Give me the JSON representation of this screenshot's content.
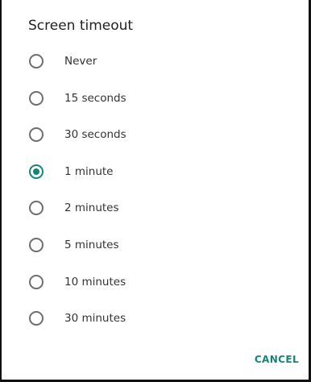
{
  "dialog": {
    "title": "Screen timeout",
    "accent_color": "#15857a",
    "options": [
      {
        "label": "Never",
        "selected": false
      },
      {
        "label": "15 seconds",
        "selected": false
      },
      {
        "label": "30 seconds",
        "selected": false
      },
      {
        "label": "1 minute",
        "selected": true
      },
      {
        "label": "2 minutes",
        "selected": false
      },
      {
        "label": "5 minutes",
        "selected": false
      },
      {
        "label": "10 minutes",
        "selected": false
      },
      {
        "label": "30 minutes",
        "selected": false
      }
    ],
    "cancel_label": "CANCEL"
  }
}
